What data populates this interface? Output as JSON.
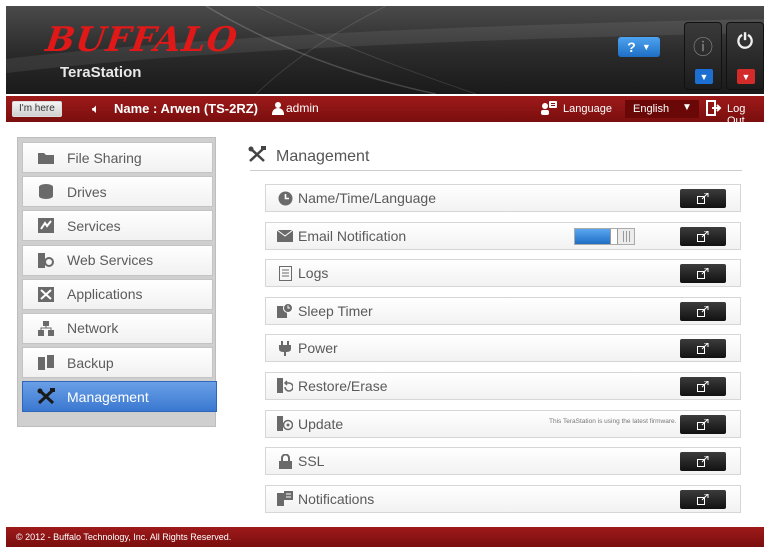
{
  "header": {
    "logo": "BUFFALO",
    "product": "TeraStation",
    "help_label": "?",
    "info_icon": "info-circle-icon",
    "power_icon": "power-icon"
  },
  "topbar": {
    "im_here_label": "I'm here",
    "device_name": "Name : Arwen (TS-2RZ)",
    "user": "admin",
    "language_label": "Language",
    "language_value": "English",
    "logout_label": "Log Out"
  },
  "sidebar": {
    "items": [
      {
        "label": "File Sharing",
        "icon": "folder-icon"
      },
      {
        "label": "Drives",
        "icon": "drive-icon"
      },
      {
        "label": "Services",
        "icon": "services-icon"
      },
      {
        "label": "Web Services",
        "icon": "web-services-icon"
      },
      {
        "label": "Applications",
        "icon": "applications-icon"
      },
      {
        "label": "Network",
        "icon": "network-icon"
      },
      {
        "label": "Backup",
        "icon": "backup-icon"
      },
      {
        "label": "Management",
        "icon": "tools-icon",
        "active": true
      }
    ]
  },
  "main": {
    "title": "Management",
    "rows": [
      {
        "label": "Name/Time/Language",
        "icon": "clock-icon"
      },
      {
        "label": "Email Notification",
        "icon": "envelope-icon",
        "toggle": "on"
      },
      {
        "label": "Logs",
        "icon": "logs-icon"
      },
      {
        "label": "Sleep Timer",
        "icon": "sleep-timer-icon"
      },
      {
        "label": "Power",
        "icon": "plug-icon"
      },
      {
        "label": "Restore/Erase",
        "icon": "restore-icon"
      },
      {
        "label": "Update",
        "icon": "update-icon",
        "note": "This TeraStation is using the latest firmware."
      },
      {
        "label": "SSL",
        "icon": "lock-icon"
      },
      {
        "label": "Notifications",
        "icon": "notifications-icon"
      }
    ]
  },
  "footer": {
    "copyright": "© 2012 - Buffalo Technology, Inc. All Rights Reserved."
  },
  "colors": {
    "brand_red": "#e01818",
    "bar_red": "#8c1414",
    "accent_blue": "#3a78d0"
  }
}
